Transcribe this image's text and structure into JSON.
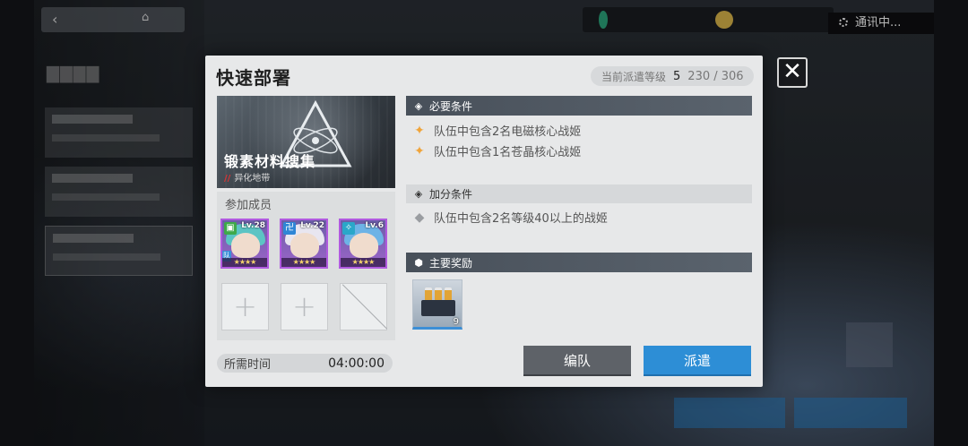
{
  "status": {
    "comm_text": "通讯中..."
  },
  "dialog": {
    "title": "快速部署",
    "level_label": "当前派遣等级",
    "level_value": "5",
    "xp_text": "230 / 306",
    "mission": {
      "name": "锻素材料搜集",
      "region": "异化地带"
    },
    "members_label": "参加成员",
    "members": [
      {
        "level": "Lv.28",
        "stars": "★★★★",
        "tag": "队"
      },
      {
        "level": "Lv.22",
        "stars": "★★★★"
      },
      {
        "level": "Lv.6",
        "stars": "★★★★"
      }
    ],
    "time_label": "所需时间",
    "time_value": "04:00:00",
    "required_header": "必要条件",
    "required_conditions": [
      "队伍中包含2名电磁核心战姬",
      "队伍中包含1名苍晶核心战姬"
    ],
    "bonus_header": "加分条件",
    "bonus_conditions": [
      "队伍中包含2名等级40以上的战姬"
    ],
    "reward_header": "主要奖励",
    "reward_qty": "9",
    "team_button": "编队",
    "dispatch_button": "派遣"
  },
  "colors": {
    "accent_blue": "#2d8ed6",
    "condition_met": "#f0a43a",
    "condition_unmet": "#9a9da1",
    "header_dark": "#48505a"
  },
  "icons": {
    "close": "close-x-icon",
    "required": "diamond-split-icon",
    "bonus": "diamond-split-icon",
    "reward": "hexagon-icon"
  }
}
